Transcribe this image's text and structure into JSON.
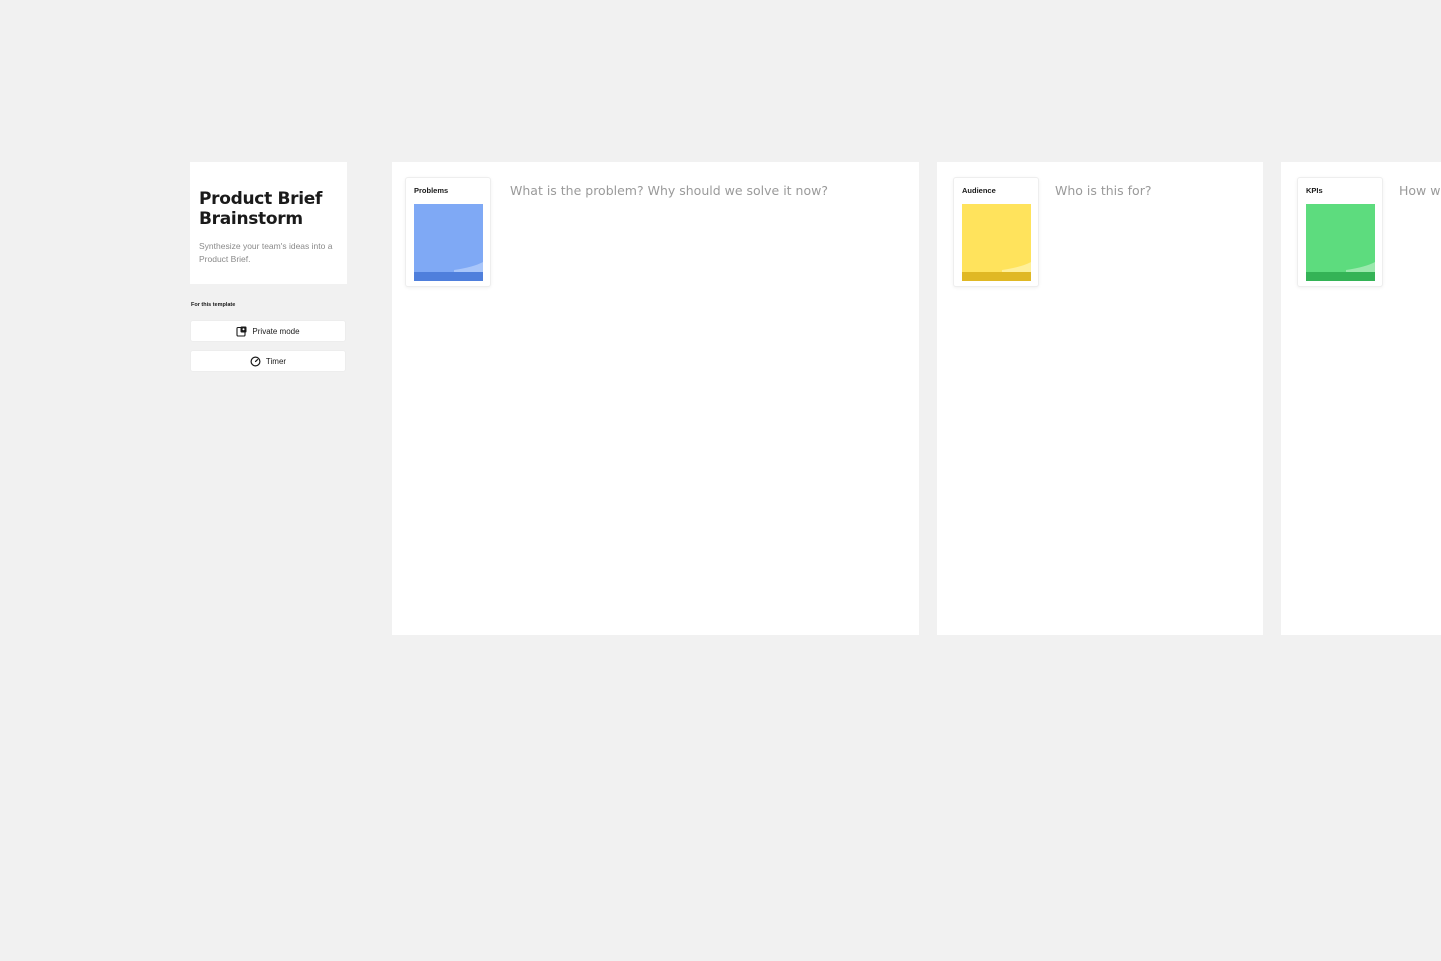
{
  "intro": {
    "title_line1": "Product Brief",
    "title_line2": "Brainstorm",
    "description": "Synthesize your team's ideas into a Product Brief."
  },
  "template_tools": {
    "heading": "For this template",
    "private_mode_label": "Private mode",
    "private_mode_icon": "private-mode-icon",
    "timer_label": "Timer",
    "timer_icon": "timer-icon"
  },
  "frames": [
    {
      "label": "Problems",
      "question": "What is the problem? Why should we solve it now?",
      "note_color": "#7fa9f5",
      "note_edge_color": "#4f7fdc"
    },
    {
      "label": "Audience",
      "question": "Who is this for?",
      "note_color": "#ffe35c",
      "note_edge_color": "#e0b824"
    },
    {
      "label": "KPIs",
      "question": "How wi",
      "note_color": "#5ddc7e",
      "note_edge_color": "#34b356"
    }
  ]
}
